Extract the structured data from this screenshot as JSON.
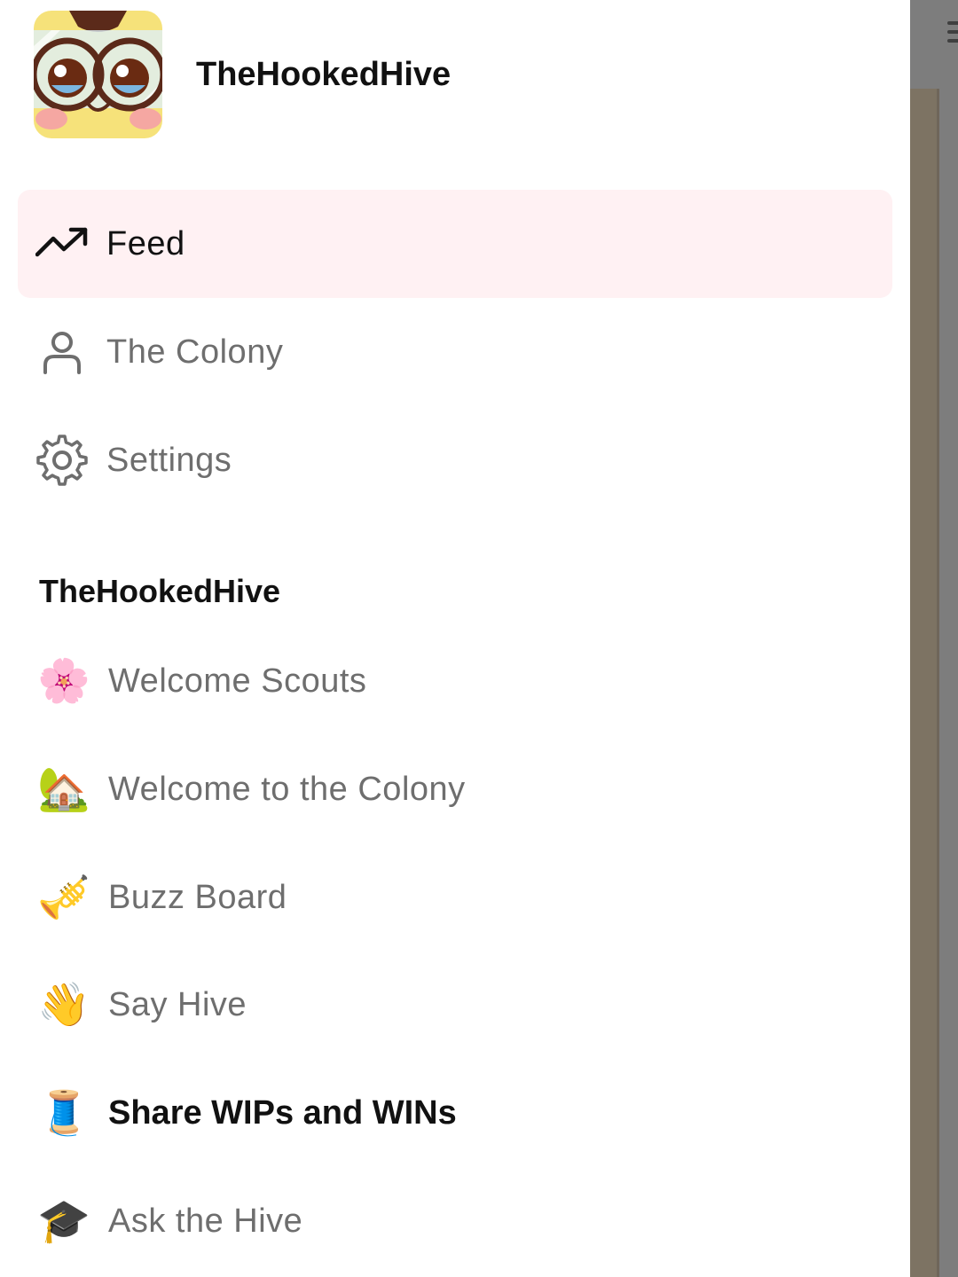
{
  "app": {
    "name": "TheHookedHive"
  },
  "nav": {
    "items": [
      {
        "label": "Feed",
        "icon": "trending-up-icon",
        "active": true
      },
      {
        "label": "The Colony",
        "icon": "person-icon",
        "active": false
      },
      {
        "label": "Settings",
        "icon": "gear-icon",
        "active": false
      }
    ]
  },
  "section": {
    "title": "TheHookedHive"
  },
  "channels": [
    {
      "emoji": "🌸",
      "icon": "cherry-blossom-icon",
      "label": "Welcome Scouts",
      "unread": false
    },
    {
      "emoji": "🏡",
      "icon": "house-garden-icon",
      "label": "Welcome to the Colony",
      "unread": false
    },
    {
      "emoji": "🎺",
      "icon": "trumpet-icon",
      "label": "Buzz Board",
      "unread": false
    },
    {
      "emoji": "👋",
      "icon": "waving-hand-icon",
      "label": "Say Hive",
      "unread": false
    },
    {
      "emoji": "🧵",
      "icon": "thread-spool-icon",
      "label": "Share WIPs and WINs",
      "unread": true
    },
    {
      "emoji": "🎓",
      "icon": "graduation-cap-icon",
      "label": "Ask the Hive",
      "unread": false
    }
  ],
  "colors": {
    "active_bg": "#fff1f3",
    "text_primary": "#111111",
    "text_muted": "#6e6e6e",
    "scrim": "#7d7363"
  }
}
